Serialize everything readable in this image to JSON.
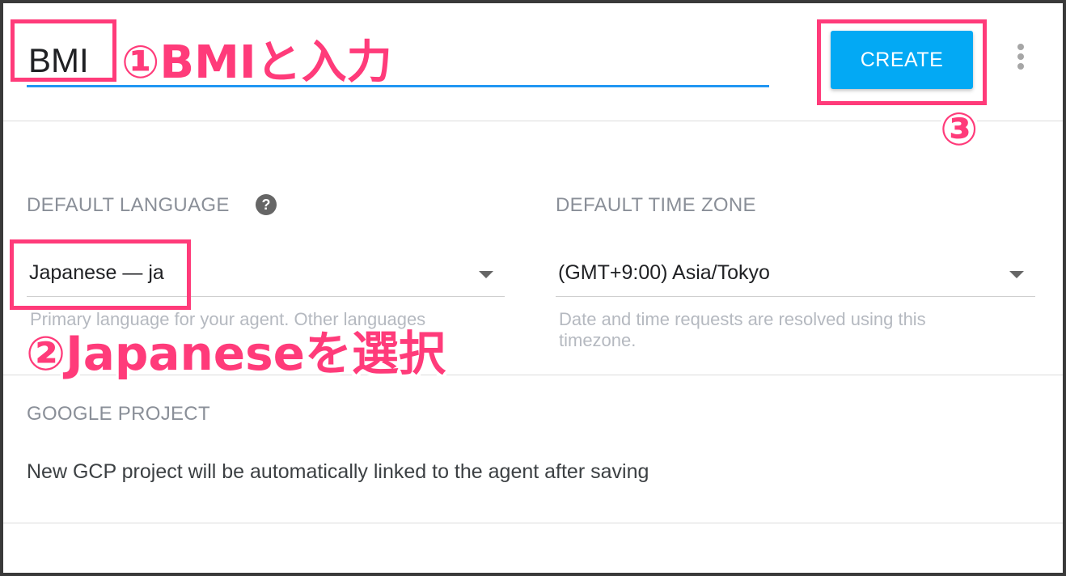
{
  "header": {
    "agent_name_value": "BMI",
    "create_label": "CREATE"
  },
  "language": {
    "label": "DEFAULT LANGUAGE",
    "help_glyph": "?",
    "selected": "Japanese — ja",
    "hint": "Primary language for your agent. Other languages"
  },
  "timezone": {
    "label": "DEFAULT TIME ZONE",
    "selected": "(GMT+9:00) Asia/Tokyo",
    "hint_line1": "Date and time requests are resolved using this",
    "hint_line2": "timezone."
  },
  "project": {
    "label": "GOOGLE PROJECT",
    "text": "New GCP project will be automatically linked to the agent after saving"
  },
  "annotations": {
    "step1": "①BMIと入力",
    "step2": "②Japaneseを選択",
    "step3": "③"
  },
  "colors": {
    "accent": "#03a9f4",
    "underline": "#2196f3",
    "annotation": "#ff3b7a"
  }
}
